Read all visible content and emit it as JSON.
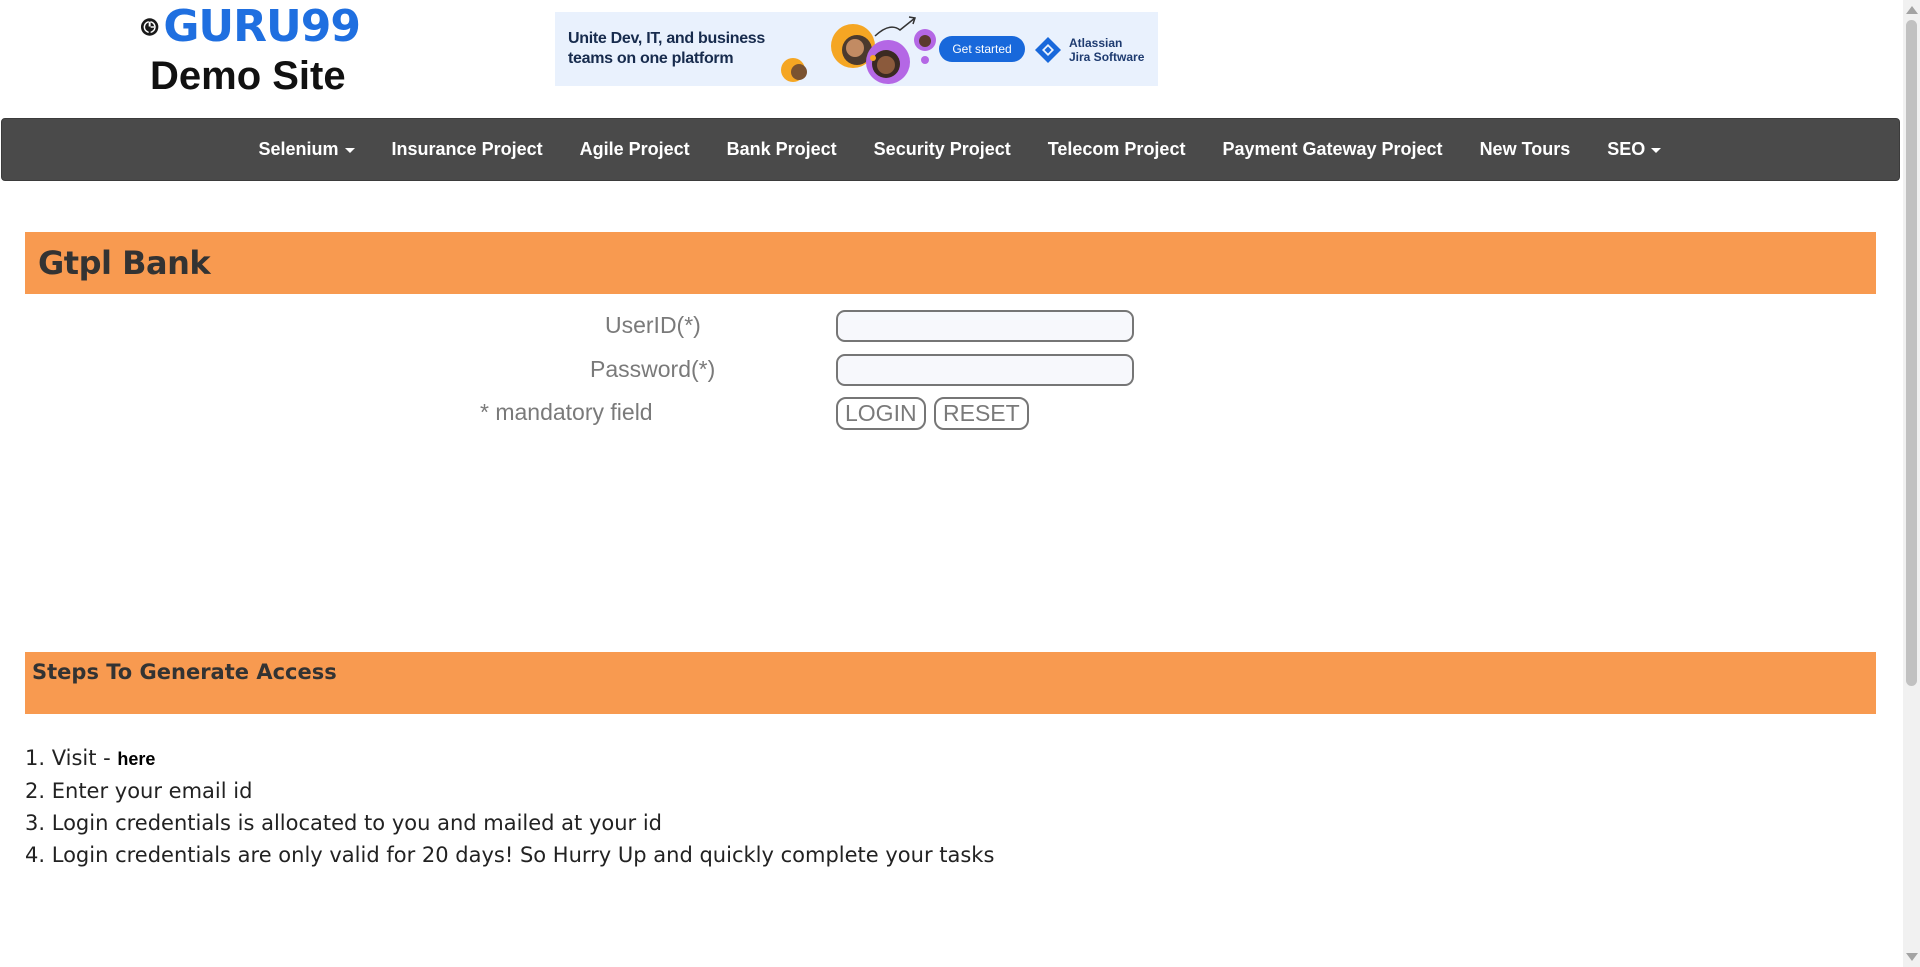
{
  "header": {
    "logo_brand": "GURU99",
    "logo_subtitle": "Demo Site"
  },
  "ad": {
    "headline": "Unite Dev, IT, and business teams on one platform",
    "cta_label": "Get started",
    "brand_line1": "Atlassian",
    "brand_line2": "Jira Software",
    "colors": {
      "background": "#e9f1fd",
      "cta": "#1868db",
      "brand": "#1e3b70"
    }
  },
  "nav": {
    "items": [
      {
        "label": "Selenium",
        "dropdown": true
      },
      {
        "label": "Insurance Project",
        "dropdown": false
      },
      {
        "label": "Agile Project",
        "dropdown": false
      },
      {
        "label": "Bank Project",
        "dropdown": false
      },
      {
        "label": "Security Project",
        "dropdown": false
      },
      {
        "label": "Telecom Project",
        "dropdown": false
      },
      {
        "label": "Payment Gateway Project",
        "dropdown": false
      },
      {
        "label": "New Tours",
        "dropdown": false
      },
      {
        "label": "SEO",
        "dropdown": true
      }
    ],
    "colors": {
      "background": "#4a4a4a",
      "text": "#ffffff"
    }
  },
  "bank": {
    "title": "Gtpl Bank",
    "userid_label": "UserID(*)",
    "userid_value": "",
    "password_label": "Password(*)",
    "password_value": "",
    "mandatory_note": "* mandatory field",
    "login_label": "LOGIN",
    "reset_label": "RESET"
  },
  "steps": {
    "title": "Steps To Generate Access",
    "items": [
      {
        "number": "1.",
        "text": "Visit - ",
        "link": "here"
      },
      {
        "number": "2.",
        "text": "Enter your email id"
      },
      {
        "number": "3.",
        "text": "Login credentials is allocated to you and mailed at your id"
      },
      {
        "number": "4.",
        "text": "Login credentials are only valid for 20 days! So Hurry Up and quickly complete your tasks"
      }
    ]
  },
  "theme": {
    "accent_orange": "#f89a50",
    "brand_blue": "#1f6fe0"
  }
}
